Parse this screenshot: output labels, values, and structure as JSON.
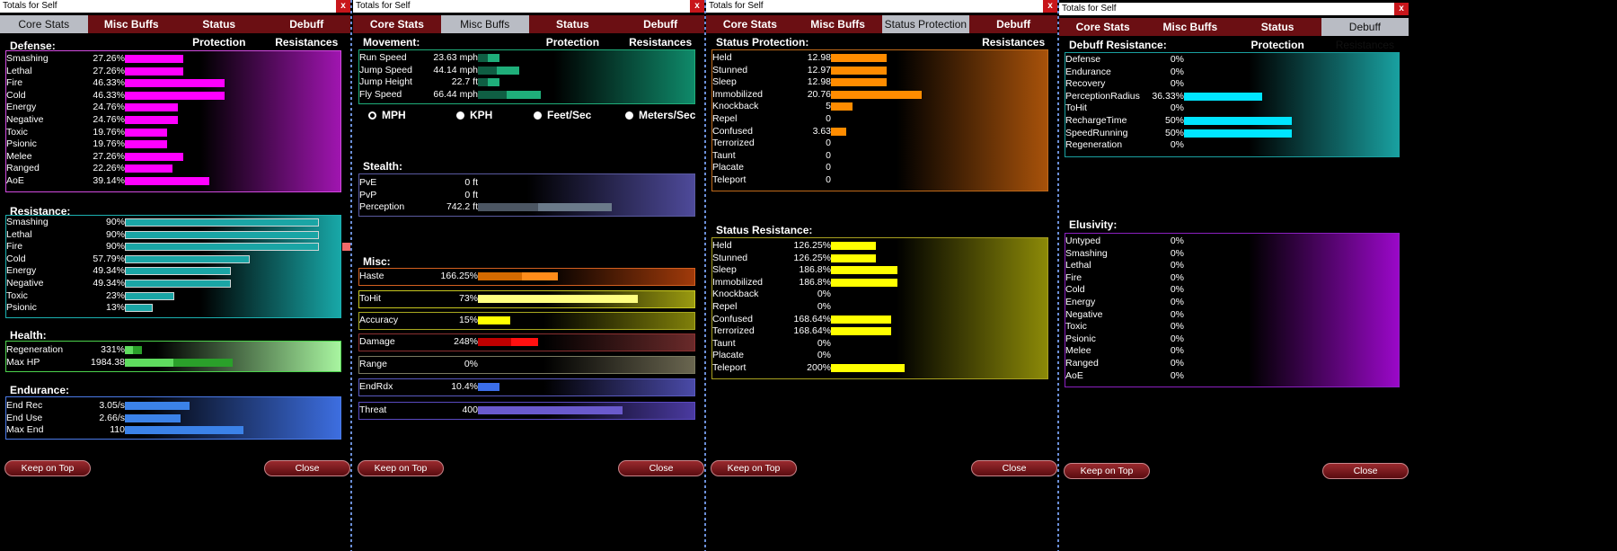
{
  "title": "Totals for Self",
  "close_glyph": "x",
  "tabs": [
    "Core Stats",
    "Misc Buffs",
    "Status Protection",
    "Debuff Resistances"
  ],
  "buttons": {
    "keep_on_top": "Keep on Top",
    "close": "Close"
  },
  "colors": {
    "defense": "#ff00ff",
    "resistance": "#1aa5a5",
    "health": "#2aa02a",
    "endurance": "#3b82e8",
    "movement": "#1fae7a",
    "stealth": "#6b7a8a",
    "status_prot": "#ff8c00",
    "status_res": "#ffff00",
    "debuff": "#00e5ff"
  },
  "core": {
    "defense": {
      "title": "Defense:",
      "rows": [
        {
          "label": "Smashing",
          "value": "27.26%",
          "pct": 27.26
        },
        {
          "label": "Lethal",
          "value": "27.26%",
          "pct": 27.26
        },
        {
          "label": "Fire",
          "value": "46.33%",
          "pct": 46.33
        },
        {
          "label": "Cold",
          "value": "46.33%",
          "pct": 46.33
        },
        {
          "label": "Energy",
          "value": "24.76%",
          "pct": 24.76
        },
        {
          "label": "Negative",
          "value": "24.76%",
          "pct": 24.76
        },
        {
          "label": "Toxic",
          "value": "19.76%",
          "pct": 19.76
        },
        {
          "label": "Psionic",
          "value": "19.76%",
          "pct": 19.76
        },
        {
          "label": "Melee",
          "value": "27.26%",
          "pct": 27.26
        },
        {
          "label": "Ranged",
          "value": "22.26%",
          "pct": 22.26
        },
        {
          "label": "AoE",
          "value": "39.14%",
          "pct": 39.14
        }
      ]
    },
    "resistance": {
      "title": "Resistance:",
      "rows": [
        {
          "label": "Smashing",
          "value": "90%",
          "pct": 90
        },
        {
          "label": "Lethal",
          "value": "90%",
          "pct": 90
        },
        {
          "label": "Fire",
          "value": "90%",
          "pct": 90,
          "over": true
        },
        {
          "label": "Cold",
          "value": "57.79%",
          "pct": 57.79
        },
        {
          "label": "Energy",
          "value": "49.34%",
          "pct": 49.34
        },
        {
          "label": "Negative",
          "value": "49.34%",
          "pct": 49.34
        },
        {
          "label": "Toxic",
          "value": "23%",
          "pct": 23
        },
        {
          "label": "Psionic",
          "value": "13%",
          "pct": 13
        }
      ]
    },
    "health": {
      "title": "Health:",
      "rows": [
        {
          "label": "Regeneration",
          "value": "331%",
          "pct": 8
        },
        {
          "label": "Max HP",
          "value": "1984.38",
          "pct": 50
        }
      ]
    },
    "endurance": {
      "title": "Endurance:",
      "rows": [
        {
          "label": "End Rec",
          "value": "3.05/s",
          "pct": 30
        },
        {
          "label": "End Use",
          "value": "2.66/s",
          "pct": 26
        },
        {
          "label": "Max End",
          "value": "110",
          "pct": 55
        }
      ]
    }
  },
  "misc": {
    "movement": {
      "title": "Movement:",
      "rows": [
        {
          "label": "Run Speed",
          "value": "23.63 mph",
          "pct": 10
        },
        {
          "label": "Jump Speed",
          "value": "44.14 mph",
          "pct": 19
        },
        {
          "label": "Jump Height",
          "value": "22.7 ft",
          "pct": 10
        },
        {
          "label": "Fly Speed",
          "value": "66.44 mph",
          "pct": 29
        }
      ],
      "units": [
        "MPH",
        "KPH",
        "Feet/Sec",
        "Meters/Sec"
      ]
    },
    "stealth": {
      "title": "Stealth:",
      "rows": [
        {
          "label": "PvE",
          "value": "0 ft",
          "pct": 0
        },
        {
          "label": "PvP",
          "value": "0 ft",
          "pct": 0
        },
        {
          "label": "Perception",
          "value": "742.2 ft",
          "pct": 62
        }
      ]
    },
    "misc": {
      "title": "Misc:",
      "rows": [
        {
          "label": "Haste",
          "value": "166.25%",
          "pct": 37
        },
        {
          "label": "ToHit",
          "value": "73%",
          "pct": 74
        },
        {
          "label": "Accuracy",
          "value": "15%",
          "pct": 15
        },
        {
          "label": "Damage",
          "value": "248%",
          "pct": 28
        },
        {
          "label": "Range",
          "value": "0%",
          "pct": 0
        },
        {
          "label": "EndRdx",
          "value": "10.4%",
          "pct": 10
        },
        {
          "label": "Threat",
          "value": "400",
          "pct": 67
        }
      ]
    }
  },
  "status": {
    "protection": {
      "title": "Status Protection:",
      "rows": [
        {
          "label": "Held",
          "value": "12.98",
          "pct": 26
        },
        {
          "label": "Stunned",
          "value": "12.97",
          "pct": 26
        },
        {
          "label": "Sleep",
          "value": "12.98",
          "pct": 26
        },
        {
          "label": "Immobilized",
          "value": "20.76",
          "pct": 42
        },
        {
          "label": "Knockback",
          "value": "5",
          "pct": 10
        },
        {
          "label": "Repel",
          "value": "0",
          "pct": 0
        },
        {
          "label": "Confused",
          "value": "3.63",
          "pct": 7
        },
        {
          "label": "Terrorized",
          "value": "0",
          "pct": 0
        },
        {
          "label": "Taunt",
          "value": "0",
          "pct": 0
        },
        {
          "label": "Placate",
          "value": "0",
          "pct": 0
        },
        {
          "label": "Teleport",
          "value": "0",
          "pct": 0
        }
      ]
    },
    "resistance": {
      "title": "Status Resistance:",
      "rows": [
        {
          "label": "Held",
          "value": "126.25%",
          "pct": 21
        },
        {
          "label": "Stunned",
          "value": "126.25%",
          "pct": 21
        },
        {
          "label": "Sleep",
          "value": "186.8%",
          "pct": 31
        },
        {
          "label": "Immobilized",
          "value": "186.8%",
          "pct": 31
        },
        {
          "label": "Knockback",
          "value": "0%",
          "pct": 0
        },
        {
          "label": "Repel",
          "value": "0%",
          "pct": 0
        },
        {
          "label": "Confused",
          "value": "168.64%",
          "pct": 28
        },
        {
          "label": "Terrorized",
          "value": "168.64%",
          "pct": 28
        },
        {
          "label": "Taunt",
          "value": "0%",
          "pct": 0
        },
        {
          "label": "Placate",
          "value": "0%",
          "pct": 0
        },
        {
          "label": "Teleport",
          "value": "200%",
          "pct": 34
        }
      ]
    }
  },
  "debuff": {
    "resistance": {
      "title": "Debuff Resistance:",
      "rows": [
        {
          "label": "Defense",
          "value": "0%",
          "pct": 0
        },
        {
          "label": "Endurance",
          "value": "0%",
          "pct": 0
        },
        {
          "label": "Recovery",
          "value": "0%",
          "pct": 0
        },
        {
          "label": "PerceptionRadius",
          "value": "36.33%",
          "pct": 36.33
        },
        {
          "label": "ToHit",
          "value": "0%",
          "pct": 0
        },
        {
          "label": "RechargeTime",
          "value": "50%",
          "pct": 50
        },
        {
          "label": "SpeedRunning",
          "value": "50%",
          "pct": 50
        },
        {
          "label": "Regeneration",
          "value": "0%",
          "pct": 0
        }
      ]
    },
    "elusivity": {
      "title": "Elusivity:",
      "rows": [
        {
          "label": "Untyped",
          "value": "0%",
          "pct": 0
        },
        {
          "label": "Smashing",
          "value": "0%",
          "pct": 0
        },
        {
          "label": "Lethal",
          "value": "0%",
          "pct": 0
        },
        {
          "label": "Fire",
          "value": "0%",
          "pct": 0
        },
        {
          "label": "Cold",
          "value": "0%",
          "pct": 0
        },
        {
          "label": "Energy",
          "value": "0%",
          "pct": 0
        },
        {
          "label": "Negative",
          "value": "0%",
          "pct": 0
        },
        {
          "label": "Toxic",
          "value": "0%",
          "pct": 0
        },
        {
          "label": "Psionic",
          "value": "0%",
          "pct": 0
        },
        {
          "label": "Melee",
          "value": "0%",
          "pct": 0
        },
        {
          "label": "Ranged",
          "value": "0%",
          "pct": 0
        },
        {
          "label": "AoE",
          "value": "0%",
          "pct": 0
        }
      ]
    }
  }
}
